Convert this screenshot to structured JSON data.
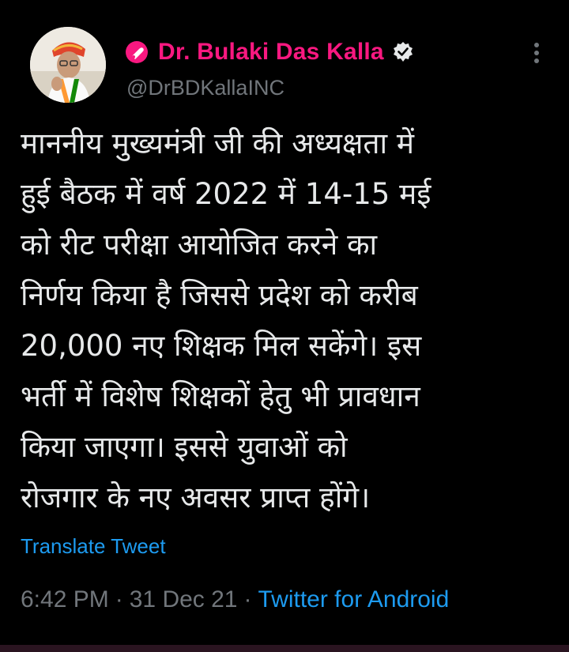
{
  "tweet": {
    "author": {
      "display_name": "Dr. Bulaki Das Kalla",
      "handle": "@DrBDKallaINC",
      "verified": true
    },
    "body_lines": [
      "माननीय मुख्यमंत्री जी की अध्यक्षता में",
      "हुई बैठक में वर्ष 2022 में 14-15 मई",
      "को रीट परीक्षा आयोजित करने का",
      "निर्णय किया है जिससे प्रदेश को करीब",
      "20,000 नए शिक्षक मिल सकेंगे। इस",
      "भर्ती में विशेष शिक्षकों हेतु भी प्रावधान",
      "किया जाएगा। इससे युवाओं को",
      "रोजगार के नए अवसर प्राप्त होंगे।"
    ],
    "translate_label": "Translate Tweet",
    "time": "6:42 PM",
    "date": "31 Dec 21",
    "source": "Twitter for Android",
    "separator": "·"
  },
  "colors": {
    "background": "#000000",
    "name_accent": "#f91880",
    "link": "#1d9bf0",
    "secondary_text": "#71767b",
    "body_text": "#e7e9ea"
  },
  "icons": {
    "party": "party-symbol-icon",
    "verified": "verified-badge-icon",
    "more": "more-options-icon"
  }
}
